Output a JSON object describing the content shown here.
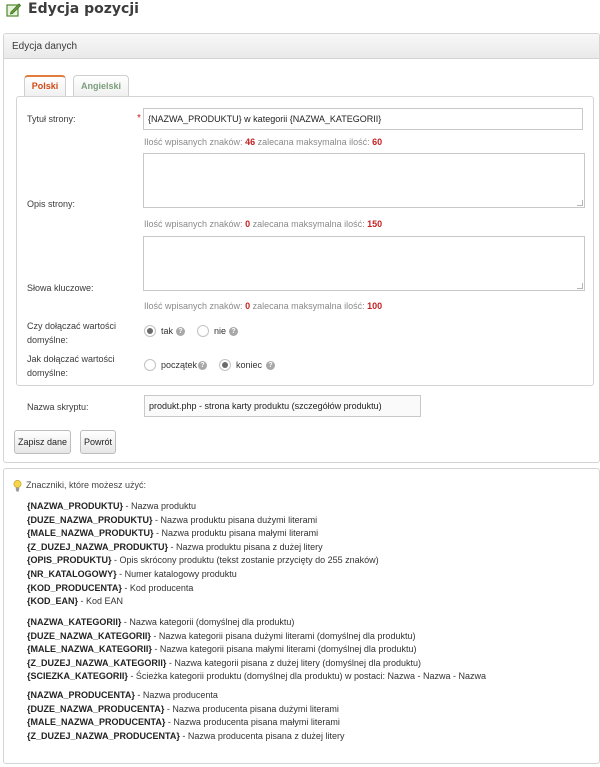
{
  "page": {
    "title": "Edycja pozycji",
    "icon": "edit-icon"
  },
  "panel": {
    "title": "Edycja danych"
  },
  "tabs": [
    {
      "label": "Polski",
      "active": true
    },
    {
      "label": "Angielski",
      "active": false
    }
  ],
  "form": {
    "title_label": "Tytuł strony:",
    "title_value": "{NAZWA_PRODUKTU} w kategorii {NAZWA_KATEGORII}",
    "title_counter": {
      "prefix": "Ilość wpisanych znaków:",
      "count": "46",
      "middle": "zalecana maksymalna ilość:",
      "max": "60"
    },
    "desc_label": "Opis strony:",
    "desc_value": "",
    "desc_counter": {
      "prefix": "Ilość wpisanych znaków:",
      "count": "0",
      "middle": "zalecana maksymalna ilość:",
      "max": "150"
    },
    "keywords_label": "Słowa kluczowe:",
    "keywords_value": "",
    "keywords_counter": {
      "prefix": "Ilość wpisanych znaków:",
      "count": "0",
      "middle": "zalecana maksymalna ilość:",
      "max": "100"
    },
    "default_q_line1": "Czy dołączać wartości",
    "default_q_line2": "domyślne:",
    "default_yes": "tak",
    "default_no": "nie",
    "default_selected": "tak",
    "how_q_line1": "Jak dołączać wartości",
    "how_q_line2": "domyślne:",
    "how_start": "początek",
    "how_end": "koniec",
    "how_selected": "koniec",
    "script_label": "Nazwa skryptu:",
    "script_value": "produkt.php - strona karty produktu (szczegółów produktu)"
  },
  "buttons": {
    "save": "Zapisz dane",
    "back": "Powrót"
  },
  "info": {
    "title": "Znaczniki, które możesz użyć:",
    "group1": [
      {
        "tag": "{NAZWA_PRODUKTU}",
        "desc": " - Nazwa produktu"
      },
      {
        "tag": "{DUZE_NAZWA_PRODUKTU}",
        "desc": " - Nazwa produktu pisana dużymi literami"
      },
      {
        "tag": "{MALE_NAZWA_PRODUKTU}",
        "desc": " - Nazwa produktu pisana małymi literami"
      },
      {
        "tag": "{Z_DUZEJ_NAZWA_PRODUKTU}",
        "desc": " - Nazwa produktu pisana z dużej litery"
      },
      {
        "tag": "{OPIS_PRODUKTU}",
        "desc": " - Opis skrócony produktu (tekst zostanie przycięty do 255 znaków)"
      },
      {
        "tag": "{NR_KATALOGOWY}",
        "desc": " - Numer katalogowy produktu"
      },
      {
        "tag": "{KOD_PRODUCENTA}",
        "desc": " - Kod producenta"
      },
      {
        "tag": "{KOD_EAN}",
        "desc": " - Kod EAN"
      }
    ],
    "group2": [
      {
        "tag": "{NAZWA_KATEGORII}",
        "desc": " - Nazwa kategorii (domyślnej dla produktu)"
      },
      {
        "tag": "{DUZE_NAZWA_KATEGORII}",
        "desc": " - Nazwa kategorii pisana dużymi literami (domyślnej dla produktu)"
      },
      {
        "tag": "{MALE_NAZWA_KATEGORII}",
        "desc": " - Nazwa kategorii pisana małymi literami (domyślnej dla produktu)"
      },
      {
        "tag": "{Z_DUZEJ_NAZWA_KATEGORII}",
        "desc": " - Nazwa kategorii pisana z dużej litery (domyślnej dla produktu)"
      },
      {
        "tag": "{SCIEZKA_KATEGORII}",
        "desc": " - Ścieżka kategorii produktu (domyślnej dla produktu) w postaci: Nazwa - Nazwa - Nazwa"
      }
    ],
    "group3": [
      {
        "tag": "{NAZWA_PRODUCENTA}",
        "desc": " - Nazwa producenta"
      },
      {
        "tag": "{DUZE_NAZWA_PRODUCENTA}",
        "desc": " - Nazwa producenta pisana dużymi literami"
      },
      {
        "tag": "{MALE_NAZWA_PRODUCENTA}",
        "desc": " - Nazwa producenta pisana małymi literami"
      },
      {
        "tag": "{Z_DUZEJ_NAZWA_PRODUCENTA}",
        "desc": " - Nazwa producenta pisana z dużej litery"
      }
    ]
  },
  "colors": {
    "accent_orange": "#d04b16",
    "counter_red": "#c42121",
    "tab_inactive": "#7c9d7c"
  }
}
